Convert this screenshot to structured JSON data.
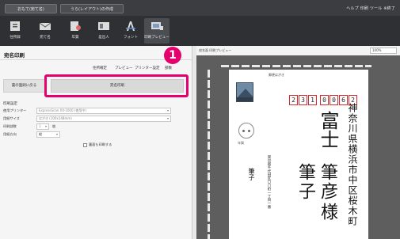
{
  "top_tabs": [
    "おもて(宛て名)",
    "うら(レイアウト)の作成"
  ],
  "top_right": "ヘルプ 印刷 ツール ※終了",
  "toolbar": [
    {
      "label": "住所録",
      "icon": "address-book-icon"
    },
    {
      "label": "宛て名",
      "icon": "envelope-icon"
    },
    {
      "label": "年賀",
      "icon": "card-icon"
    },
    {
      "label": "差出人",
      "icon": "sender-icon"
    },
    {
      "label": "フォント",
      "icon": "font-icon"
    },
    {
      "label": "印刷プレビュー",
      "icon": "print-preview-icon"
    }
  ],
  "panel": {
    "title": "宛名印刷",
    "menu": [
      "住所確定",
      "プレビュー",
      "プリンター設定",
      "部数"
    ],
    "step_number": "1",
    "button_left": "裏の面刷に戻る",
    "button_main": "宛名印刷",
    "settings_heading": "印刷設定",
    "rows": [
      {
        "label": "使用プリンター",
        "value": "ExpressScan XX-1000 (使用中)"
      },
      {
        "label": "用紙サイズ",
        "value": "はがき (100x148mm)"
      },
      {
        "label": "印刷部数",
        "value": "1",
        "unit": "枚"
      },
      {
        "label": "用紙方向",
        "value": "縦"
      }
    ],
    "checkbox_label": "裏面も印刷する"
  },
  "preview": {
    "label": "宛名面 印刷プレビュー",
    "zoom": "100%",
    "card_top": "郵便はがき",
    "zip": [
      "2",
      "3",
      "1",
      "0",
      "0",
      "6",
      "2"
    ],
    "address": "神奈川県横浜市中区桜木町",
    "city": "富士",
    "name_given": "筆彦",
    "name_family": "筆子",
    "honorific": "様",
    "sender_name": "筆子",
    "sender_addr": "東京都千代田区〇〇町一丁目一番",
    "seal_text": "年賀"
  }
}
